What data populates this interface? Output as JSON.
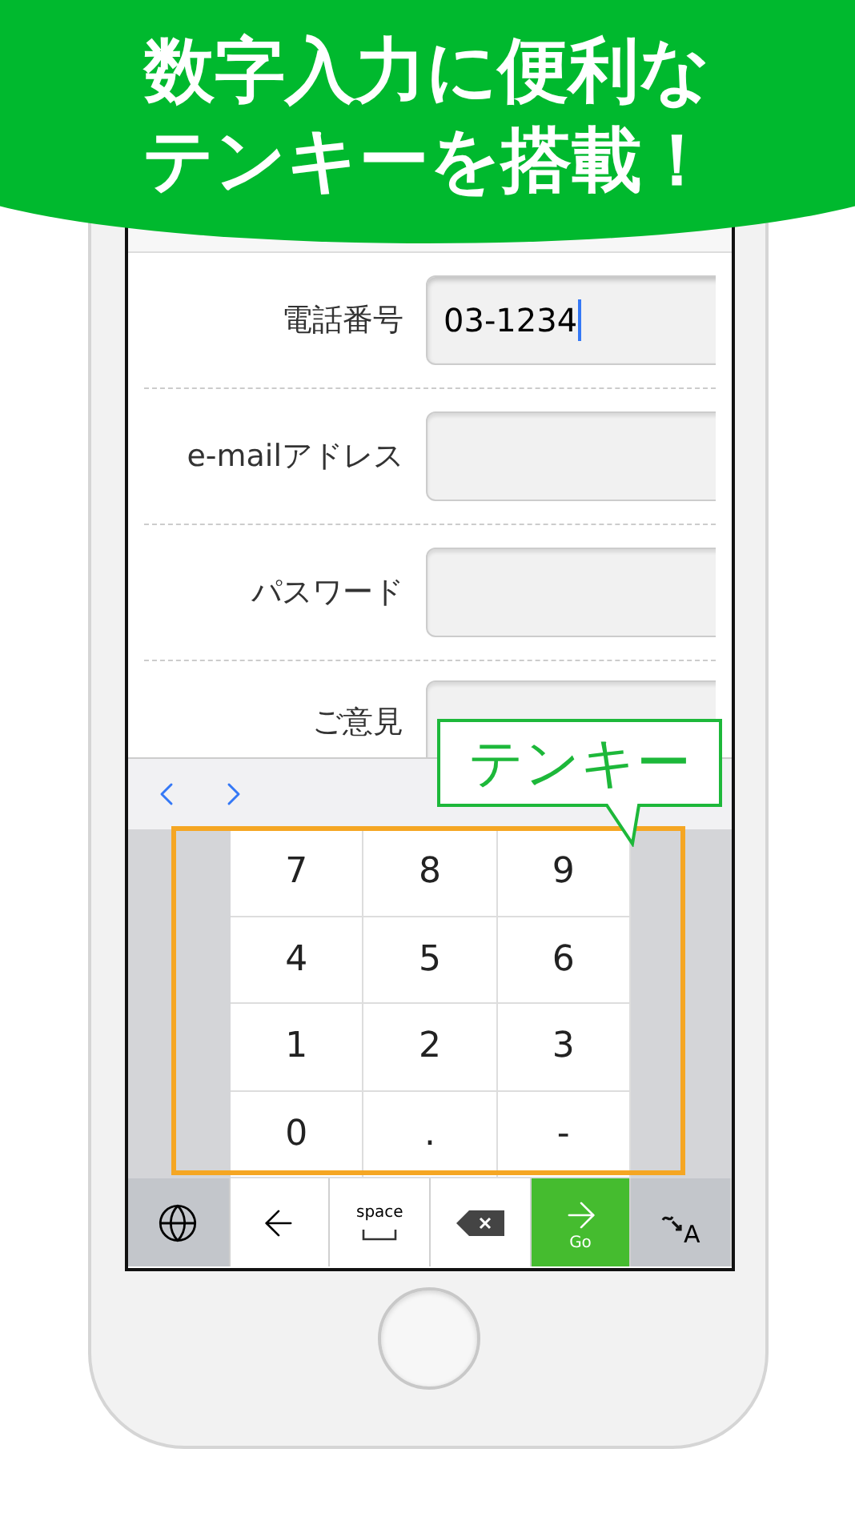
{
  "banner": {
    "lines": [
      "数字入力に便利な",
      "テンキーを搭載！"
    ]
  },
  "form": {
    "rows": [
      {
        "label": "電話番号",
        "value": "03-1234",
        "focused": true
      },
      {
        "label": "e-mailアドレス",
        "value": "",
        "focused": false
      },
      {
        "label": "パスワード",
        "value": "",
        "focused": false
      },
      {
        "label": "ご意見",
        "value": "",
        "focused": false
      }
    ]
  },
  "keypad": {
    "keys": [
      "7",
      "8",
      "9",
      "4",
      "5",
      "6",
      "1",
      "2",
      "3",
      "0",
      ".",
      "-"
    ]
  },
  "bottom_keys": [
    {
      "kind": "globe"
    },
    {
      "kind": "left"
    },
    {
      "kind": "space",
      "label": "space"
    },
    {
      "kind": "delete"
    },
    {
      "kind": "go",
      "label": "Go"
    },
    {
      "kind": "mode",
      "label": "A"
    }
  ],
  "callout": {
    "text": "テンキー"
  }
}
